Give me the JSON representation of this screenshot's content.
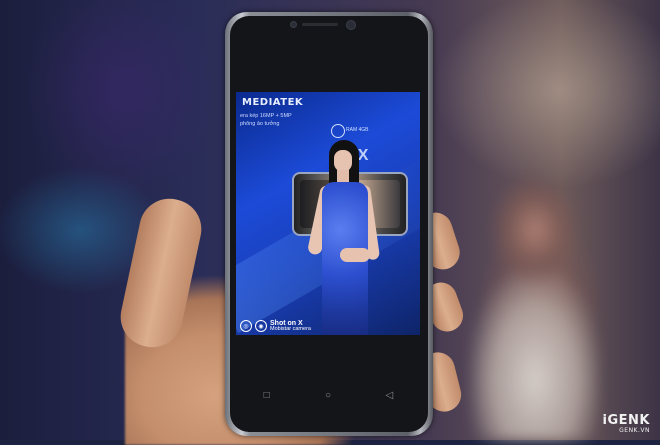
{
  "photo": {
    "description_key": "hand-holding-phone-at-event"
  },
  "phone_screen": {
    "brand_text": "MEDIATEK",
    "line1": "era kép 16MP + 5MP",
    "line2": "phông ảo tưởng",
    "ram_text": "RAM 4GB",
    "model_text": "M  X",
    "shot_title": "Shot on X",
    "shot_subtitle": "Mobistar camera"
  },
  "nav": {
    "back_icon": "◁",
    "home_icon": "○",
    "recent_icon": "□"
  },
  "watermark": {
    "logo": "iGENK",
    "url": "GENK.VN"
  },
  "colors": {
    "screen_blue": "#1c4bd8",
    "dress_blue": "#2d4fd0",
    "phone_bezel": "#141518"
  }
}
